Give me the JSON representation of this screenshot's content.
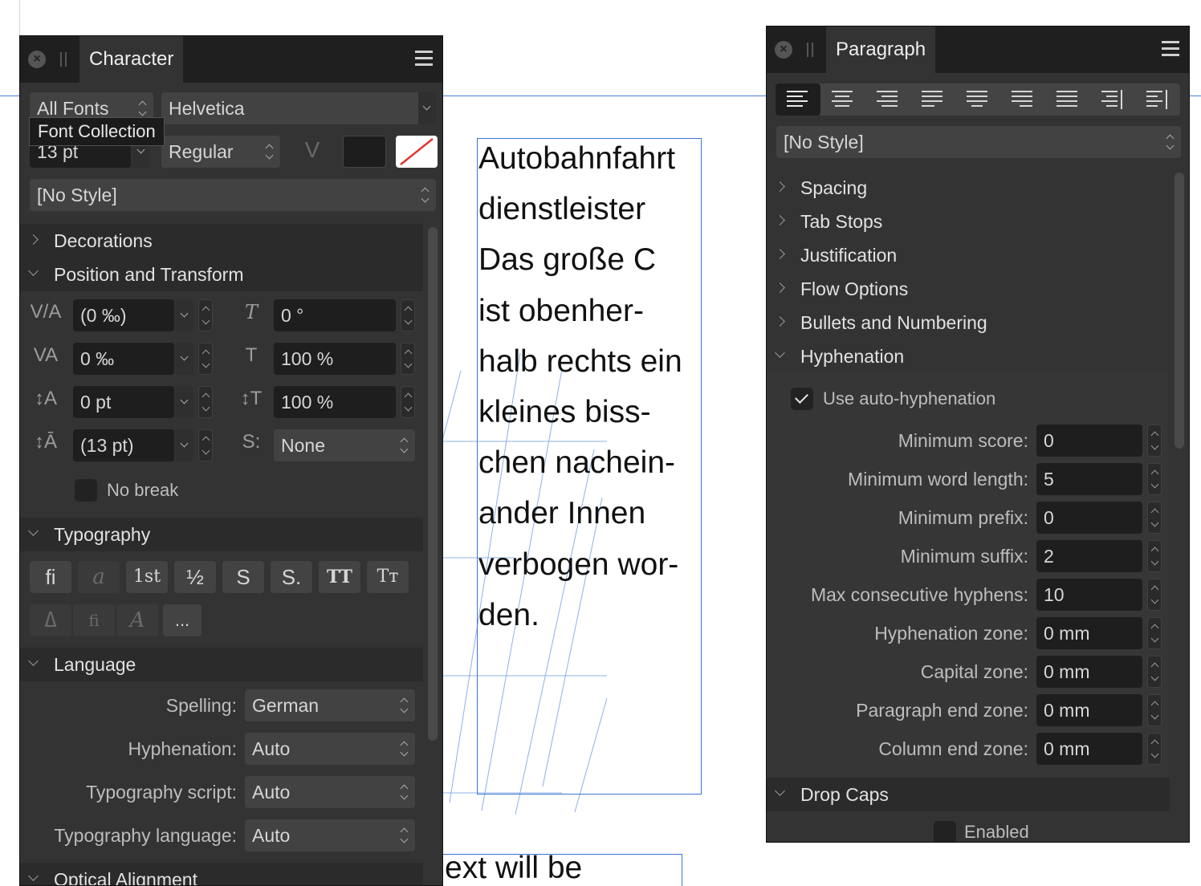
{
  "document": {
    "text_lines": [
      "Autobahnfahrt",
      "dienstleister",
      "Das große C",
      "ist obenher-",
      "halb rechts ein",
      "kleines biss-",
      "chen nachein-",
      "ander Innen",
      "verbogen wor-",
      "den."
    ],
    "frame2_text": "ext will be"
  },
  "character_panel": {
    "tab": "Character",
    "font_collection": "All Fonts",
    "font_family": "Helvetica",
    "tooltip": "Font Collection",
    "font_size": "13 pt",
    "font_style": "Regular",
    "style": "[No Style]",
    "sections": {
      "decorations": "Decorations",
      "position_transform": "Position and Transform",
      "typography": "Typography",
      "language": "Language",
      "optical_alignment": "Optical Alignment"
    },
    "fields": {
      "kerning": "(0 ‰)",
      "tracking": "0 ‰",
      "baseline": "0 pt",
      "leading": "(13 pt)",
      "shear": "0 °",
      "scale_h": "100 %",
      "scale_v": "100 %",
      "script": "None"
    },
    "no_break": "No break",
    "typography_buttons": [
      "fi",
      "a",
      "1st",
      "½",
      "S",
      "S.",
      "TT",
      "Tт"
    ],
    "typography_buttons2": [
      "ߡ",
      "fi",
      "A",
      "..."
    ],
    "language": {
      "spelling_label": "Spelling:",
      "spelling_value": "German",
      "hyphenation_label": "Hyphenation:",
      "hyphenation_value": "Auto",
      "script_label": "Typography script:",
      "script_value": "Auto",
      "language_label": "Typography language:",
      "language_value": "Auto"
    }
  },
  "paragraph_panel": {
    "tab": "Paragraph",
    "style": "[No Style]",
    "sections": {
      "spacing": "Spacing",
      "tab_stops": "Tab Stops",
      "justification": "Justification",
      "flow_options": "Flow Options",
      "bullets": "Bullets and Numbering",
      "hyphenation": "Hyphenation",
      "drop_caps": "Drop Caps"
    },
    "use_auto_hyphenation": "Use auto-hyphenation",
    "hyphen_fields": [
      {
        "label": "Minimum score:",
        "value": "0"
      },
      {
        "label": "Minimum word length:",
        "value": "5"
      },
      {
        "label": "Minimum prefix:",
        "value": "0"
      },
      {
        "label": "Minimum suffix:",
        "value": "2"
      },
      {
        "label": "Max consecutive hyphens:",
        "value": "10"
      },
      {
        "label": "Hyphenation zone:",
        "value": "0 mm"
      },
      {
        "label": "Capital zone:",
        "value": "0 mm"
      },
      {
        "label": "Paragraph end zone:",
        "value": "0 mm"
      },
      {
        "label": "Column end zone:",
        "value": "0 mm"
      }
    ],
    "enabled": "Enabled"
  }
}
